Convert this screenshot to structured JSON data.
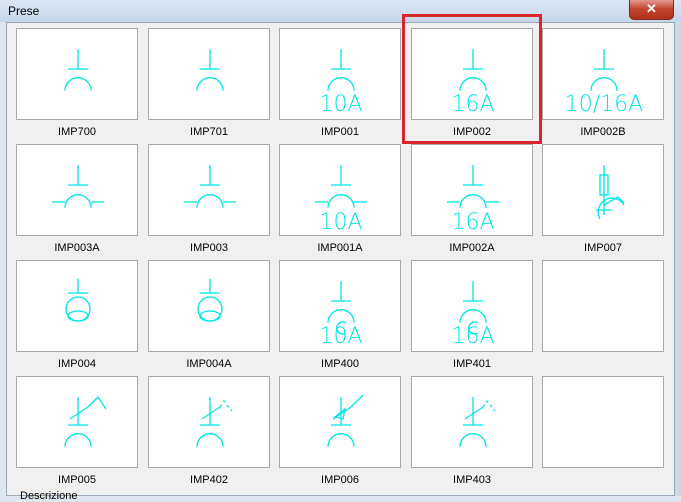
{
  "window": {
    "title": "Prese",
    "close_label": "✕"
  },
  "symbols": [
    {
      "label": "IMP700",
      "selected": false,
      "glyph": "basic",
      "text": ""
    },
    {
      "label": "IMP701",
      "selected": false,
      "glyph": "basic-closed",
      "text": ""
    },
    {
      "label": "IMP001",
      "selected": false,
      "glyph": "rating",
      "text": "10A"
    },
    {
      "label": "IMP002",
      "selected": true,
      "glyph": "rating",
      "text": "16A"
    },
    {
      "label": "IMP002B",
      "selected": false,
      "glyph": "rating",
      "text": "10/16A"
    },
    {
      "label": "IMP003A",
      "selected": false,
      "glyph": "ground-wide",
      "text": ""
    },
    {
      "label": "IMP003",
      "selected": false,
      "glyph": "ground-wide",
      "text": ""
    },
    {
      "label": "IMP001A",
      "selected": false,
      "glyph": "ground-rating",
      "text": "10A"
    },
    {
      "label": "IMP002A",
      "selected": false,
      "glyph": "ground-rating",
      "text": "16A"
    },
    {
      "label": "IMP007",
      "selected": false,
      "glyph": "fused",
      "text": ""
    },
    {
      "label": "IMP004",
      "selected": false,
      "glyph": "transformer",
      "text": ""
    },
    {
      "label": "IMP004A",
      "selected": false,
      "glyph": "transformer",
      "text": ""
    },
    {
      "label": "IMP400",
      "selected": false,
      "glyph": "rating-c",
      "text": "10A"
    },
    {
      "label": "IMP401",
      "selected": false,
      "glyph": "rating-c",
      "text": "16A"
    },
    {
      "label": "",
      "selected": false,
      "glyph": "empty",
      "text": ""
    },
    {
      "label": "IMP005",
      "selected": false,
      "glyph": "switched",
      "text": ""
    },
    {
      "label": "IMP402",
      "selected": false,
      "glyph": "switched-dashed",
      "text": ""
    },
    {
      "label": "IMP006",
      "selected": false,
      "glyph": "switched-flag",
      "text": ""
    },
    {
      "label": "IMP403",
      "selected": false,
      "glyph": "switched-dashed",
      "text": ""
    },
    {
      "label": "",
      "selected": false,
      "glyph": "empty",
      "text": ""
    }
  ],
  "colors": {
    "symbol_stroke": "#00e5e5",
    "selection_border": "#d9262d"
  },
  "footer": {
    "text": "Descrizione"
  }
}
